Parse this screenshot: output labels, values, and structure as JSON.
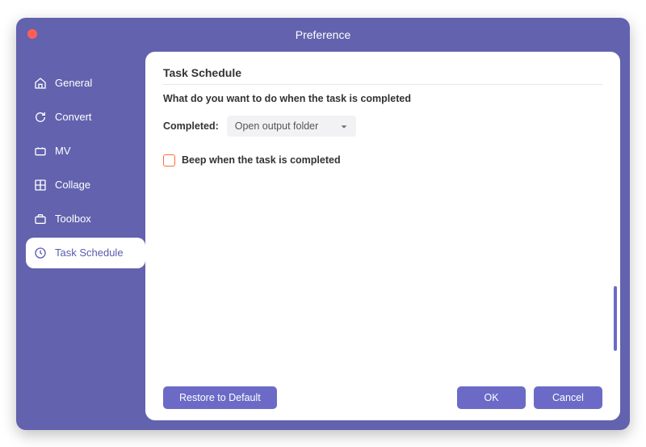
{
  "window": {
    "title": "Preference"
  },
  "sidebar": {
    "items": [
      {
        "label": "General"
      },
      {
        "label": "Convert"
      },
      {
        "label": "MV"
      },
      {
        "label": "Collage"
      },
      {
        "label": "Toolbox"
      },
      {
        "label": "Task Schedule"
      }
    ],
    "active_index": 5
  },
  "panel": {
    "title": "Task Schedule",
    "subtitle": "What do you want to do when the task is completed",
    "completed_label": "Completed:",
    "completed_value": "Open output folder",
    "beep_label": "Beep when the task is completed",
    "beep_checked": false
  },
  "buttons": {
    "restore": "Restore to Default",
    "ok": "OK",
    "cancel": "Cancel"
  }
}
